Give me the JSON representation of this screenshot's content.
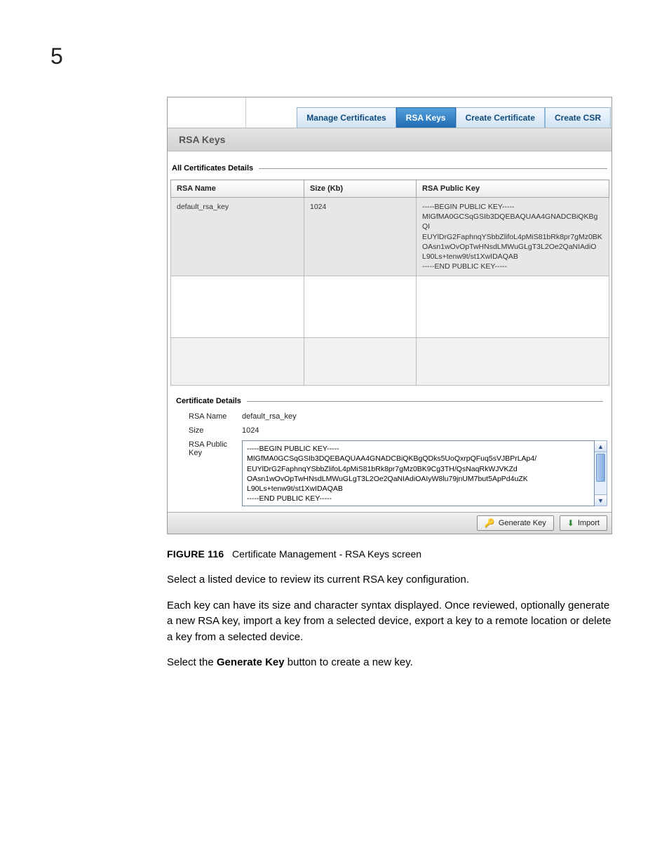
{
  "page_number": "5",
  "tabs": {
    "manage": "Manage Certificates",
    "rsa": "RSA Keys",
    "create_cert": "Create Certificate",
    "create_csr": "Create CSR"
  },
  "panel_title": "RSA Keys",
  "section1_label": "All Certificates Details",
  "grid": {
    "headers": {
      "name": "RSA Name",
      "size": "Size (Kb)",
      "pub": "RSA Public Key"
    },
    "row": {
      "name": "default_rsa_key",
      "size": "1024",
      "pub": "-----BEGIN PUBLIC KEY-----\nMIGfMA0GCSqGSIb3DQEBAQUAA4GNADCBiQKBgQI\nEUYlDrG2FaphnqYSbbZlifoL4pMiS81bRk8pr7gMz0BK\nOAsn1wOvOpTwHNsdLMWuGLgT3L2Oe2QaNIAdiO\nL90Ls+tenw9t/st1XwIDAQAB\n-----END PUBLIC KEY-----"
    }
  },
  "section2_label": "Certificate Details",
  "details": {
    "name_label": "RSA Name",
    "name_value": "default_rsa_key",
    "size_label": "Size",
    "size_value": "1024",
    "pub_label": "RSA Public Key",
    "pub_value": "-----BEGIN PUBLIC KEY-----\nMIGfMA0GCSqGSIb3DQEBAQUAA4GNADCBiQKBgQDks5UoQxrpQFuq5sVJBPrLAp4/\nEUYlDrG2FaphnqYSbbZlifoL4pMiS81bRk8pr7gMz0BK9Cg3TH/QsNaqRkWJVKZd\nOAsn1wOvOpTwHNsdLMWuGLgT3L2Oe2QaNIAdiOAIyW8lu79jnUM7but5ApPd4uZK\nL90Ls+tenw9t/st1XwIDAQAB\n-----END PUBLIC KEY-----"
  },
  "buttons": {
    "generate": "Generate Key",
    "import": "Import"
  },
  "figure": {
    "label": "FIGURE 116",
    "caption": "Certificate Management - RSA Keys screen"
  },
  "paragraphs": {
    "p1": "Select a listed device to review its current RSA key configuration.",
    "p2": "Each key can have its size and character syntax displayed. Once reviewed, optionally generate a new RSA key, import a key from a selected device, export a key to a remote location or delete a key from a selected device.",
    "p3a": "Select the ",
    "p3b": "Generate Key",
    "p3c": " button to create a new key."
  }
}
